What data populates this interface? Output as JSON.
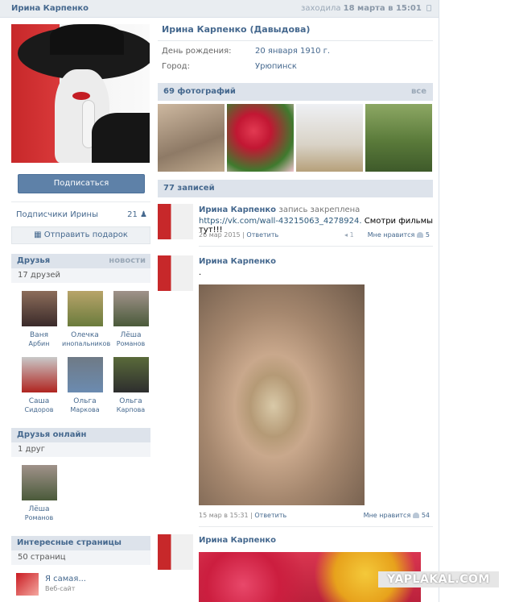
{
  "header": {
    "name": "Ирина Карпенко",
    "status_prefix": "заходила",
    "status_date": "18 марта в 15:01"
  },
  "profile": {
    "full_name": "Ирина Карпенко (Давыдова)",
    "info": [
      {
        "label": "День рождения:",
        "value": "20 января 1910 г."
      },
      {
        "label": "Город:",
        "value": "Урюпинск"
      }
    ],
    "subscribe_label": "Подписаться",
    "subscribers_label": "Подписчики Ирины",
    "subscribers_count": "21",
    "gift_label": "Отправить подарок"
  },
  "friends": {
    "title": "Друзья",
    "news_label": "новости",
    "count_label": "17 друзей",
    "items": [
      {
        "first": "Ваня",
        "last": "Арбин"
      },
      {
        "first": "Олечка",
        "last": "инопальников"
      },
      {
        "first": "Лёша",
        "last": "Романов"
      },
      {
        "first": "Саша",
        "last": "Сидоров"
      },
      {
        "first": "Ольга",
        "last": "Маркова"
      },
      {
        "first": "Ольга",
        "last": "Карпова"
      }
    ]
  },
  "online": {
    "title": "Друзья онлайн",
    "count_label": "1 друг",
    "items": [
      {
        "first": "Лёша",
        "last": "Романов"
      }
    ]
  },
  "pages": {
    "title": "Интересные страницы",
    "count_label": "50 страниц",
    "items": [
      {
        "name": "Я самая...",
        "type": "Веб-сайт"
      }
    ]
  },
  "photos": {
    "title": "69 фотографий",
    "all_label": "все"
  },
  "wall": {
    "title": "77 записей",
    "posts": [
      {
        "author": "Ирина Карпенко",
        "action": "запись закреплена",
        "link": "https://vk.com/wall-43215063_4278924.",
        "text": "Смотри фильмы тут!!!",
        "date": "26 мар 2015",
        "reply": "Ответить",
        "shares": "1",
        "likes_label": "Мне нравится",
        "likes": "5"
      },
      {
        "author": "Ирина Карпенко",
        "text": ".",
        "date": "15 мар в 15:31",
        "reply": "Ответить",
        "likes_label": "Мне нравится",
        "likes": "54"
      },
      {
        "author": "Ирина Карпенко"
      }
    ]
  },
  "watermark": "YAPLAKAL.COM"
}
